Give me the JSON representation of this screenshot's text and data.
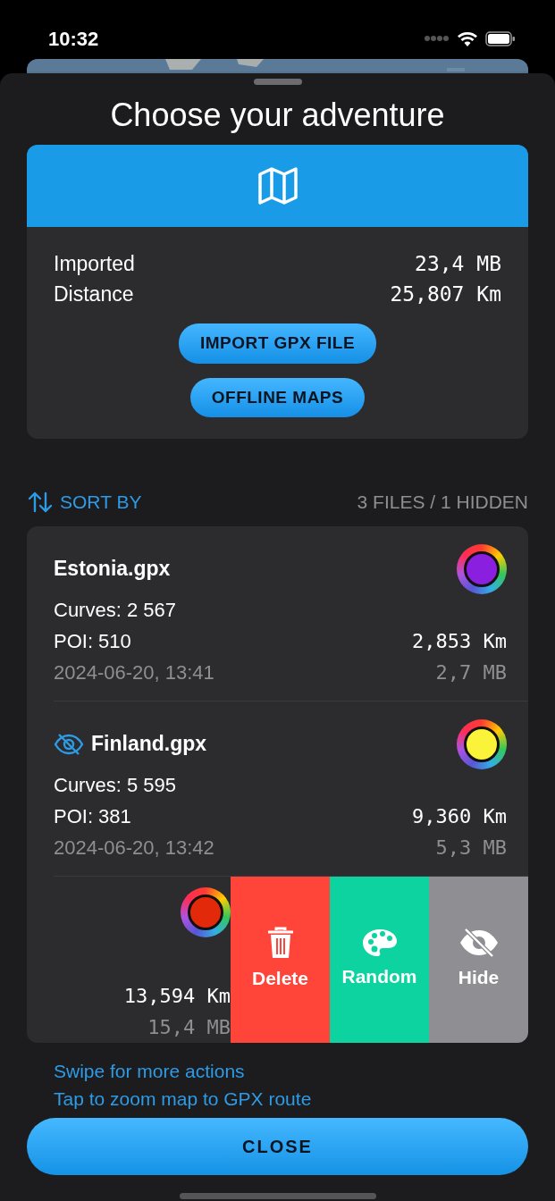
{
  "status_bar": {
    "time": "10:32"
  },
  "title": "Choose your adventure",
  "summary": {
    "stats": [
      {
        "label": "Imported",
        "value": "23,4 MB"
      },
      {
        "label": "Distance",
        "value": "25,807 Km"
      }
    ],
    "buttons": [
      "IMPORT GPX FILE",
      "OFFLINE MAPS"
    ]
  },
  "sort": {
    "label": "SORT BY",
    "count": "3 FILES / 1 HIDDEN"
  },
  "files": [
    {
      "name": "Estonia.gpx",
      "hidden": false,
      "swiped": false,
      "color": "#8a1fe0",
      "curves": "Curves: 2 567",
      "poi": "POI: 510",
      "date": "2024-06-20, 13:41",
      "distance": "2,853 Km",
      "size": "2,7 MB"
    },
    {
      "name": "Finland.gpx",
      "hidden": true,
      "swiped": false,
      "color": "#fbf23a",
      "curves": "Curves: 5 595",
      "poi": "POI: 381",
      "date": "2024-06-20, 13:42",
      "distance": "9,360 Km",
      "size": "5,3 MB"
    },
    {
      "swiped": true,
      "color": "#e22a0a",
      "distance": "13,594 Km",
      "size": "15,4 MB",
      "actions": [
        {
          "kind": "delete",
          "label": "Delete"
        },
        {
          "kind": "random",
          "label": "Random"
        },
        {
          "kind": "hide",
          "label": "Hide"
        }
      ]
    }
  ],
  "hints": [
    "Swipe for more actions",
    "Tap to zoom map to GPX route"
  ],
  "close_button": "CLOSE"
}
